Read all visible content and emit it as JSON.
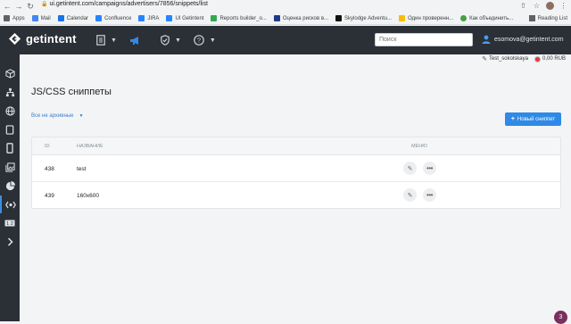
{
  "browser": {
    "url": "ui.getintent.com/campaigns/advertisers/7856/snippets/list",
    "bookmarks": [
      {
        "label": "Apps",
        "color": "#5f6368"
      },
      {
        "label": "Mail",
        "color": "#4285f4"
      },
      {
        "label": "Calendar",
        "color": "#1a73e8"
      },
      {
        "label": "Confluence",
        "color": "#2684ff"
      },
      {
        "label": "JIRA",
        "color": "#2684ff"
      },
      {
        "label": "UI Getintent",
        "color": "#2684ff"
      },
      {
        "label": "Reports builder_o...",
        "color": "#34a853"
      },
      {
        "label": "Оценка рисков в...",
        "color": "#1e3a8a"
      },
      {
        "label": "Skylodge Adventu...",
        "color": "#111111"
      },
      {
        "label": "Один проверенн...",
        "color": "#fbbc04"
      },
      {
        "label": "Как объединить...",
        "color": "#43a047"
      }
    ],
    "reading_list": "Reading List"
  },
  "header": {
    "logo_text": "getintent",
    "search_placeholder": "Поиск",
    "user_email": "esomova@getintent.com",
    "icons": [
      "document-icon",
      "megaphone-icon",
      "shield-icon",
      "help-icon"
    ]
  },
  "subheader": {
    "account": "Test_sokolskaya",
    "balance": "0,00 RUB"
  },
  "sidebar": {
    "items": [
      "cube-icon",
      "sitemap-icon",
      "globe-icon",
      "tablet-icon",
      "mobile-icon",
      "image-gallery-icon",
      "pie-chart-icon",
      "code-snippet-icon",
      "counter-icon",
      "expand-icon"
    ],
    "active_index": 7
  },
  "main": {
    "title": "JS/CSS сниппеты",
    "filter_label": "Все не архивные",
    "new_button_label": "Новый сниппет",
    "table": {
      "headers": {
        "id": "ID",
        "name": "НАЗВАНИЕ",
        "menu": "МЕНЮ"
      },
      "rows": [
        {
          "id": "438",
          "name": "test"
        },
        {
          "id": "439",
          "name": "160x600"
        }
      ]
    }
  },
  "notification_count": "3",
  "colors": {
    "accent": "#2e8ae6",
    "header_bg": "#2b2f36"
  }
}
